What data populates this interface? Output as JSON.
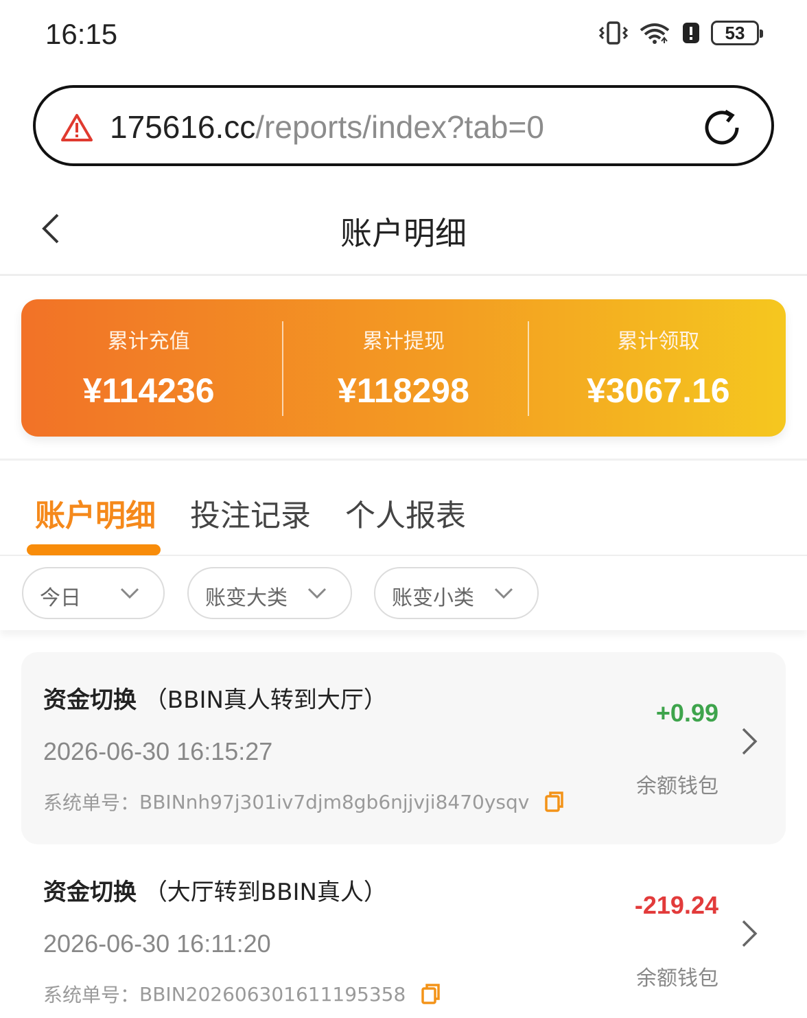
{
  "status_bar": {
    "time": "16:15",
    "battery": "53"
  },
  "browser": {
    "url_host": "175616.cc",
    "url_path": "/reports/index?tab=0"
  },
  "header": {
    "title": "账户明细"
  },
  "summary": [
    {
      "label": "累计充值",
      "value": "¥114236"
    },
    {
      "label": "累计提现",
      "value": "¥118298"
    },
    {
      "label": "累计领取",
      "value": "¥3067.16"
    }
  ],
  "tabs": [
    {
      "label": "账户明细",
      "active": true
    },
    {
      "label": "投注记录",
      "active": false
    },
    {
      "label": "个人报表",
      "active": false
    }
  ],
  "filters": [
    {
      "label": "今日"
    },
    {
      "label": "账变大类"
    },
    {
      "label": "账变小类"
    }
  ],
  "records": [
    {
      "type": "资金切换",
      "detail": "（BBIN真人转到大厅）",
      "time": "2026-06-30 16:15:27",
      "order_label": "系统单号：",
      "order_no": "BBINnh97j301iv7djm8gb6njjvji8470ysqv",
      "amount": "+0.99",
      "wallet": "余额钱包"
    },
    {
      "type": "资金切换",
      "detail": "（大厅转到BBIN真人）",
      "time": "2026-06-30 16:11:20",
      "order_label": "系统单号：",
      "order_no": "BBIN202606301611195358",
      "amount": "-219.24",
      "wallet": "余额钱包"
    }
  ],
  "colors": {
    "accent": "#f88c0a",
    "positive": "#3ea44c",
    "negative": "#e23b3b"
  }
}
